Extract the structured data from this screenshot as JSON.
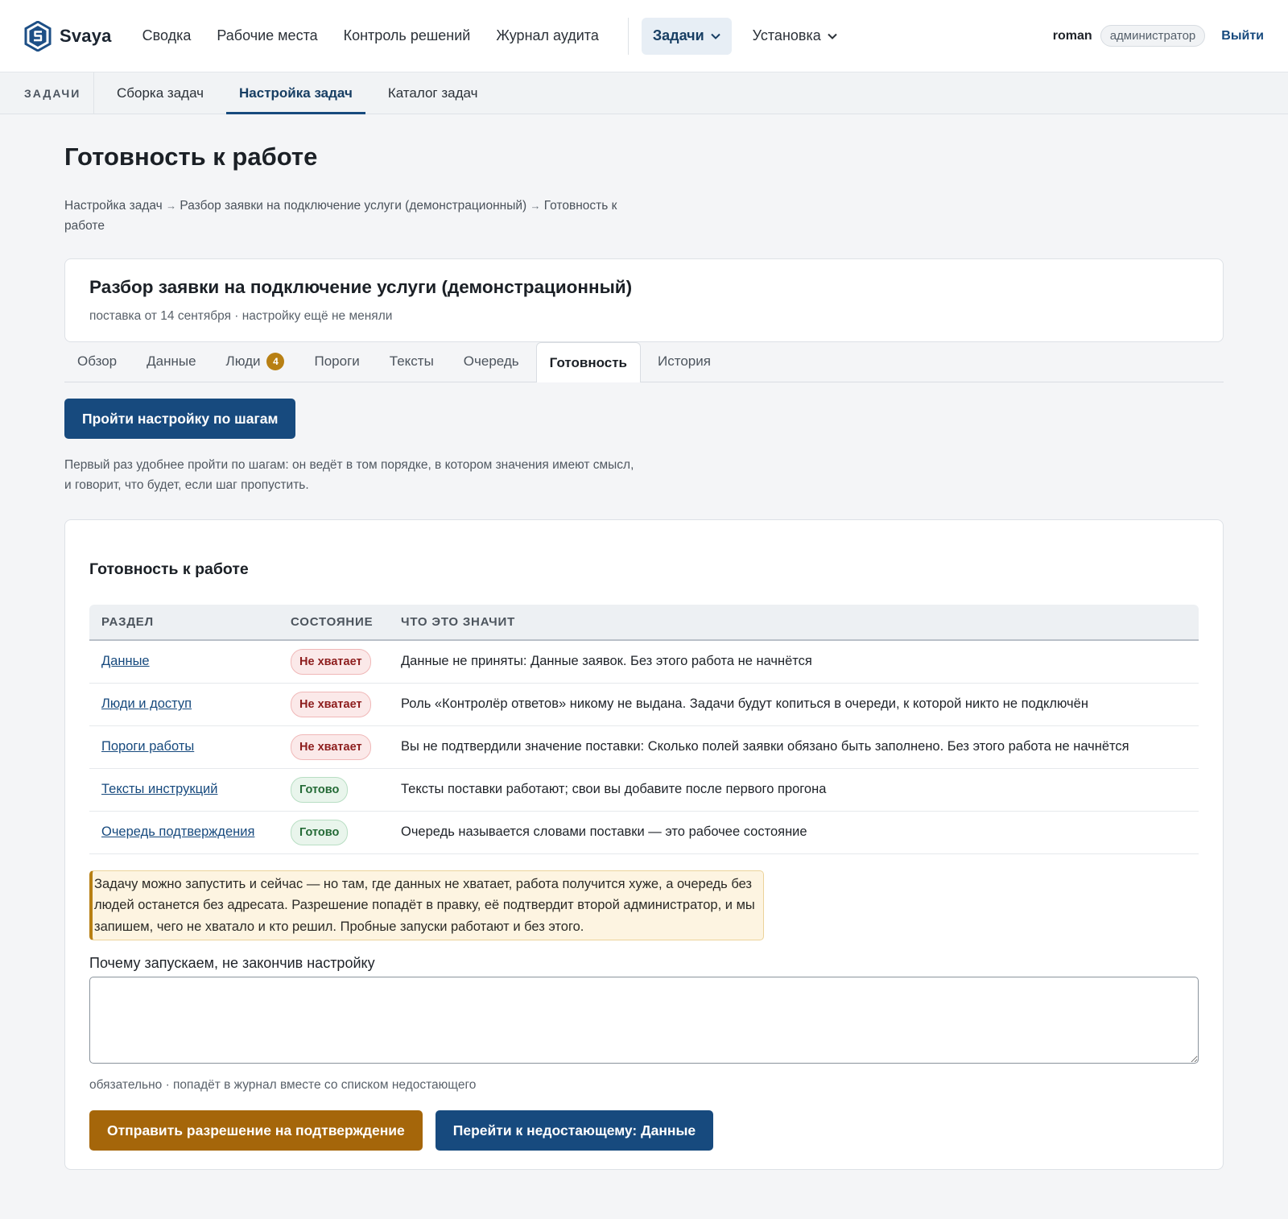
{
  "brand": {
    "name": "Svaya",
    "icon": "svaya-logo-icon"
  },
  "topnav": {
    "links": [
      "Сводка",
      "Рабочие места",
      "Контроль решений",
      "Журнал аудита"
    ],
    "active_menu": "Задачи",
    "install_menu": "Установка",
    "user": "roman",
    "role": "администратор",
    "logout": "Выйти"
  },
  "subnav": {
    "label": "ЗАДАЧИ",
    "tabs": [
      "Сборка задач",
      "Настройка задач",
      "Каталог задач"
    ],
    "active_tab": "Настройка задач"
  },
  "page": {
    "title": "Готовность к работе"
  },
  "breadcrumb": {
    "items": [
      "Настройка задач",
      "Разбор заявки на подключение услуги (демонстрационный)",
      "Готовность к работе"
    ],
    "separator": "→"
  },
  "info": {
    "title": "Разбор заявки на подключение услуги (демонстрационный)",
    "meta": "поставка от 14 сентября · настройку ещё не меняли"
  },
  "tabs": {
    "items": [
      "Обзор",
      "Данные",
      "Люди",
      "Пороги",
      "Тексты",
      "Очередь",
      "Готовность",
      "История"
    ],
    "people_count": "4",
    "active": "Готовность"
  },
  "wizard": {
    "button": "Пройти настройку по шагам",
    "hint": "Первый раз удобнее пройти по шагам: он ведёт в том порядке, в котором значения имеют смысл, и говорит, что будет, если шаг пропустить."
  },
  "readiness": {
    "title": "Готовность к работе",
    "headers": [
      "РАЗДЕЛ",
      "СОСТОЯНИЕ",
      "ЧТО ЭТО ЗНАЧИТ"
    ],
    "rows": [
      {
        "section": "Данные",
        "status": "Не хватает",
        "status_kind": "missing",
        "meaning": "Данные не приняты: Данные заявок. Без этого работа не начнётся"
      },
      {
        "section": "Люди и доступ",
        "status": "Не хватает",
        "status_kind": "missing",
        "meaning": "Роль «Контролёр ответов» никому не выдана. Задачи будут копиться в очереди, к которой никто не подключён"
      },
      {
        "section": "Пороги работы",
        "status": "Не хватает",
        "status_kind": "missing",
        "meaning": "Вы не подтвердили значение поставки: Сколько полей заявки обязано быть заполнено. Без этого работа не начнётся"
      },
      {
        "section": "Тексты инструкций",
        "status": "Готово",
        "status_kind": "ready",
        "meaning": "Тексты поставки работают; свои вы добавите после первого прогона"
      },
      {
        "section": "Очередь подтверждения",
        "status": "Готово",
        "status_kind": "ready",
        "meaning": "Очередь называется словами поставки — это рабочее состояние"
      }
    ],
    "warning": "Задачу можно запустить и сейчас — но там, где данных не хватает, работа получится хуже, а очередь без людей останется без адресата. Разрешение попадёт в правку, её подтвердит второй администратор, и мы запишем, чего не хватало и кто решил. Пробные запуски работают и без этого.",
    "reason_label": "Почему запускаем, не закончив настройку",
    "reason_value": "",
    "reason_note": "обязательно · попадёт в журнал вместе со списком недостающего",
    "submit_button": "Отправить разрешение на подтверждение",
    "goto_button": "Перейти к недостающему: Данные"
  },
  "colors": {
    "primary": "#174a7e",
    "accent_amber": "#a5660a",
    "missing_text": "#8d1d1d",
    "ready_text": "#246a36"
  }
}
